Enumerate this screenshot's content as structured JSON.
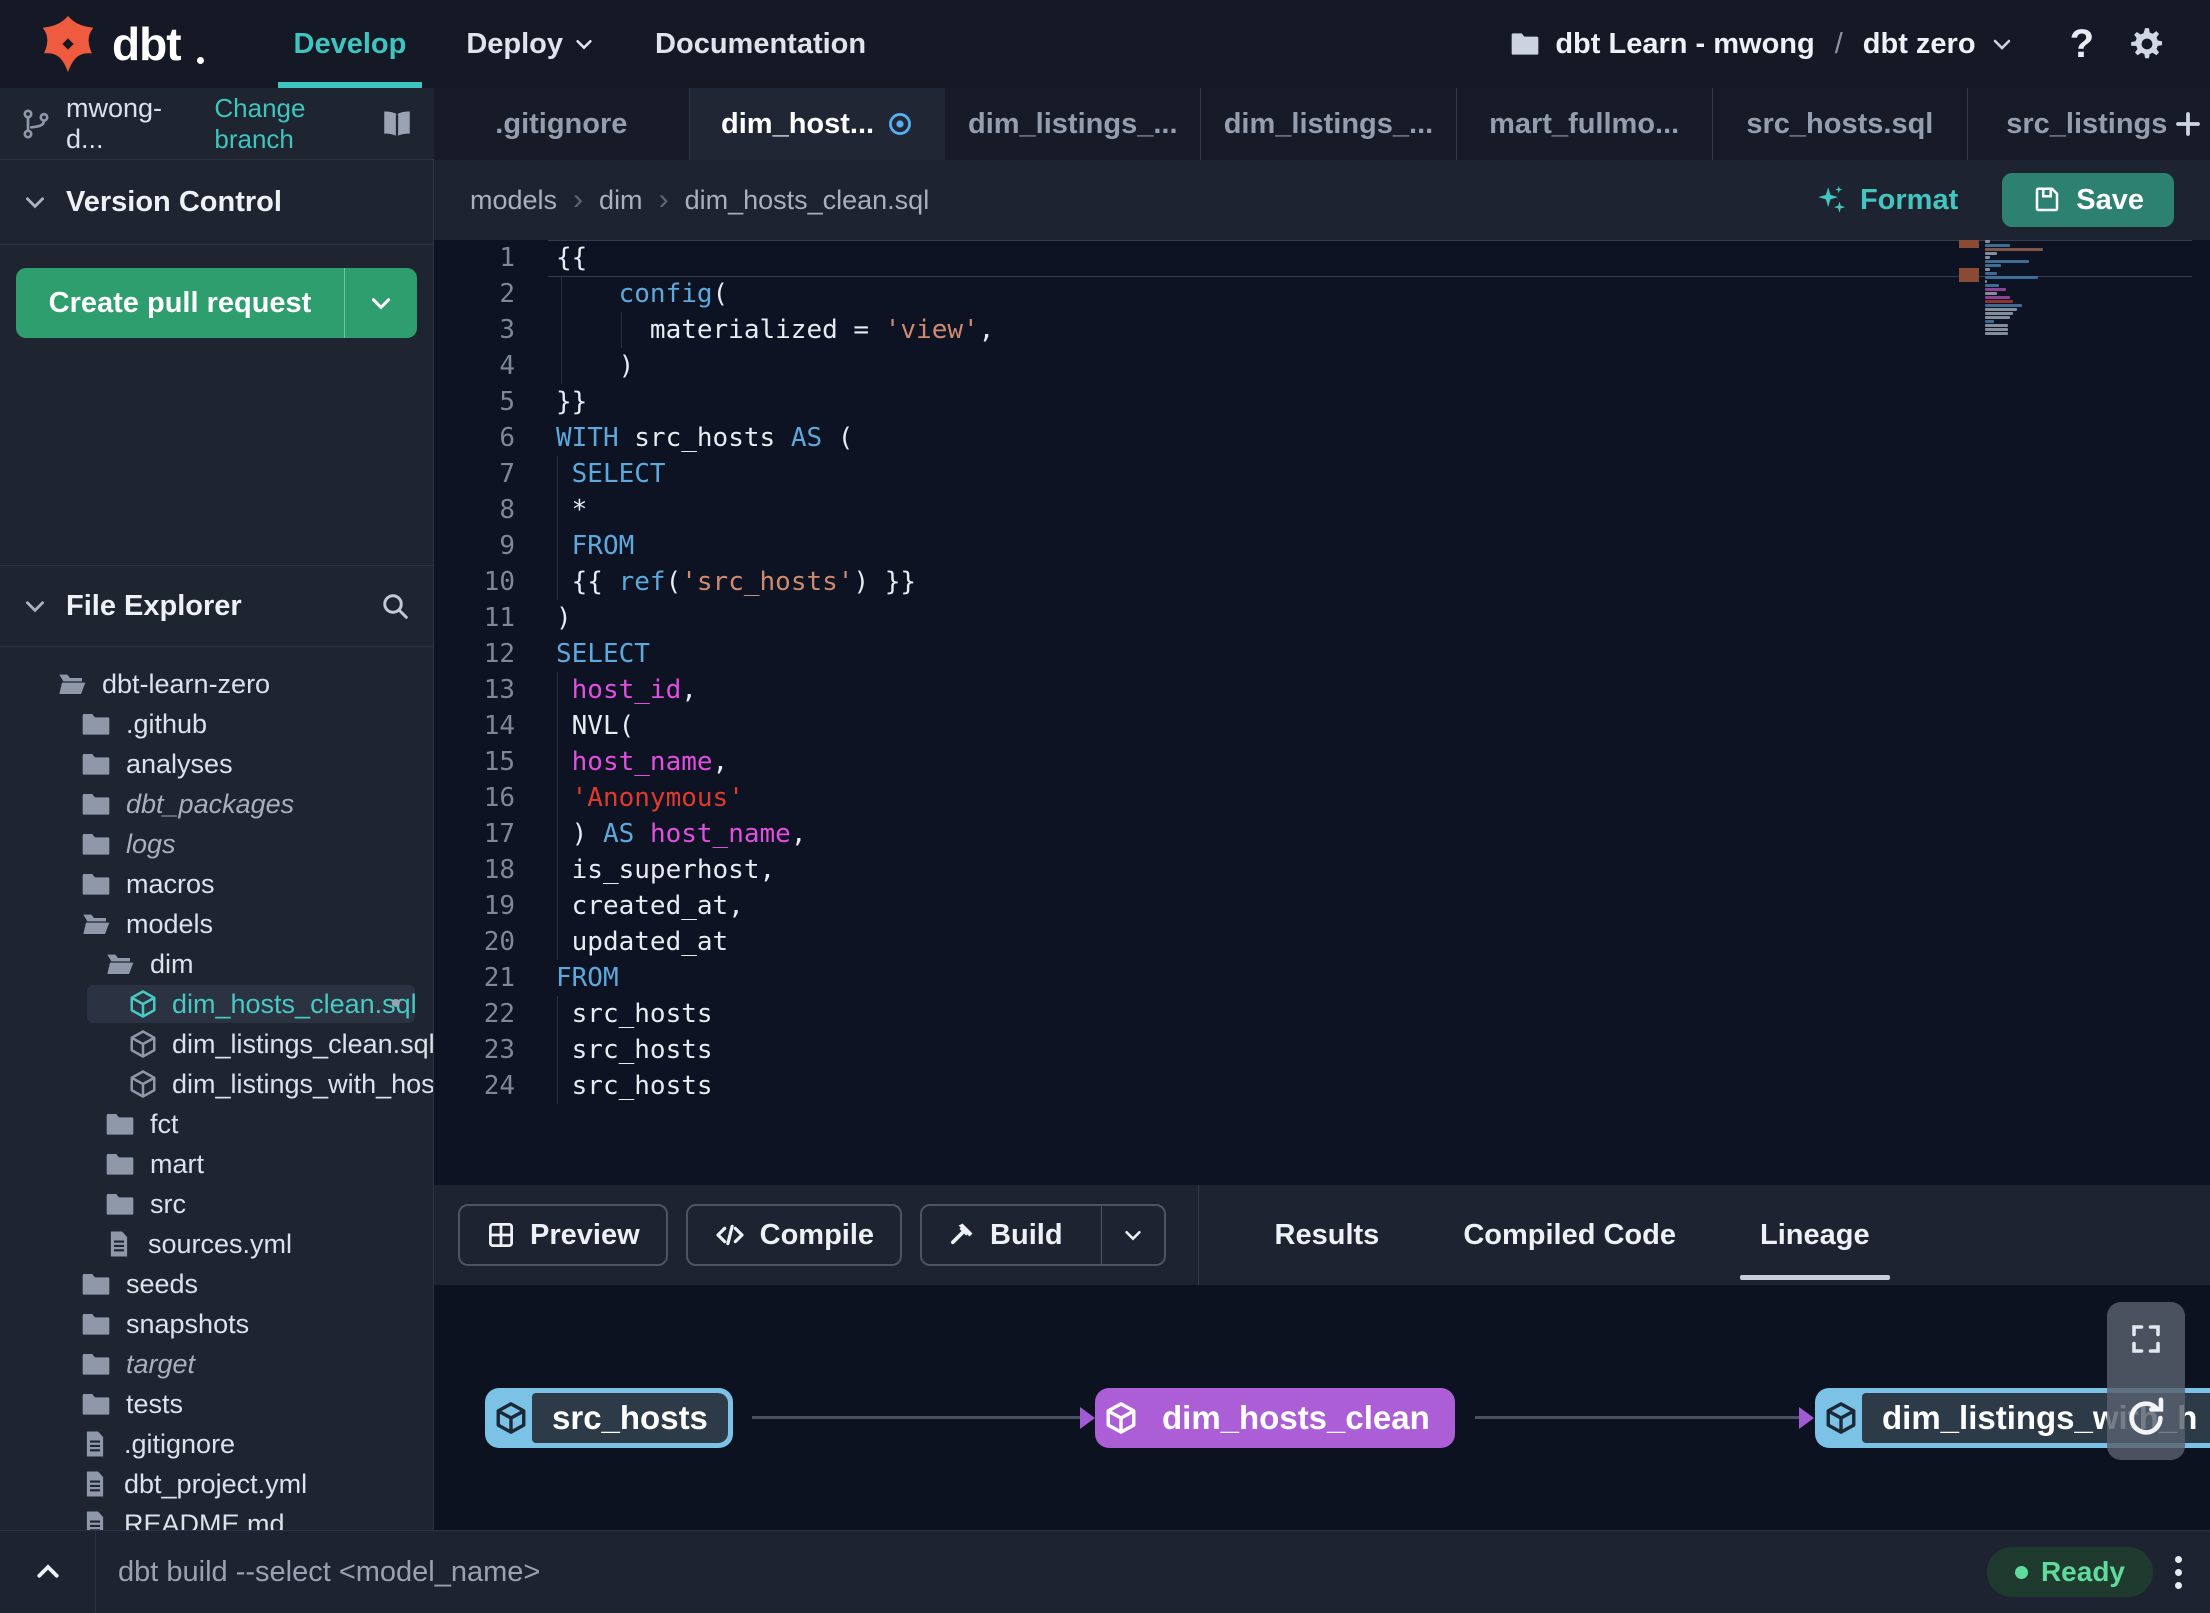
{
  "colors": {
    "brand_orange": "#ef5b3f",
    "accent_teal": "#3fc5bf",
    "button_green": "#2f9e6f",
    "save_teal": "#2c8170",
    "status_green": "#5fdc9c",
    "node_blue": "#7cc2e6",
    "node_purple": "#ac5ed7",
    "keyword_blue": "#5fa8dc",
    "ident_magenta": "#e04fdf",
    "string_coral": "#cd8a6f",
    "string_red": "#e0392d"
  },
  "navbar": {
    "brand": "dbt",
    "menu": [
      {
        "label": "Develop",
        "active": true,
        "caret": false
      },
      {
        "label": "Deploy",
        "active": false,
        "caret": true
      },
      {
        "label": "Documentation",
        "active": false,
        "caret": false
      }
    ],
    "project": {
      "name": "dbt Learn - mwong",
      "separator": "/",
      "env": "dbt zero"
    },
    "help_label": "?"
  },
  "sidebar": {
    "branch": {
      "name": "mwong-d...",
      "change_link": "Change branch"
    },
    "version_control": {
      "title": "Version Control",
      "button_label": "Create pull request"
    },
    "file_explorer": {
      "title": "File Explorer",
      "tree": [
        {
          "label": "dbt-learn-zero",
          "icon": "folder-open",
          "level": 0
        },
        {
          "label": ".github",
          "icon": "folder",
          "level": 1
        },
        {
          "label": "analyses",
          "icon": "folder",
          "level": 1
        },
        {
          "label": "dbt_packages",
          "icon": "folder",
          "level": 1,
          "italic": true
        },
        {
          "label": "logs",
          "icon": "folder",
          "level": 1,
          "italic": true
        },
        {
          "label": "macros",
          "icon": "folder",
          "level": 1
        },
        {
          "label": "models",
          "icon": "folder-open",
          "level": 1
        },
        {
          "label": "dim",
          "icon": "folder-open",
          "level": 2
        },
        {
          "label": "dim_hosts_clean.sql",
          "icon": "model",
          "level": 3,
          "selected": true,
          "modified": true
        },
        {
          "label": "dim_listings_clean.sql",
          "icon": "model",
          "level": 3
        },
        {
          "label": "dim_listings_with_hosts...",
          "icon": "model",
          "level": 3
        },
        {
          "label": "fct",
          "icon": "folder",
          "level": 2
        },
        {
          "label": "mart",
          "icon": "folder",
          "level": 2
        },
        {
          "label": "src",
          "icon": "folder",
          "level": 2
        },
        {
          "label": "sources.yml",
          "icon": "file",
          "level": 2
        },
        {
          "label": "seeds",
          "icon": "folder",
          "level": 1
        },
        {
          "label": "snapshots",
          "icon": "folder",
          "level": 1
        },
        {
          "label": "target",
          "icon": "folder",
          "level": 1,
          "italic": true
        },
        {
          "label": "tests",
          "icon": "folder",
          "level": 1
        },
        {
          "label": ".gitignore",
          "icon": "file",
          "level": 1
        },
        {
          "label": "dbt_project.yml",
          "icon": "file",
          "level": 1
        },
        {
          "label": "README.md",
          "icon": "file",
          "level": 1
        }
      ]
    }
  },
  "tabs": {
    "items": [
      {
        "label": ".gitignore"
      },
      {
        "label": "dim_host...",
        "active": true,
        "modified": true
      },
      {
        "label": "dim_listings_..."
      },
      {
        "label": "dim_listings_..."
      },
      {
        "label": "mart_fullmo..."
      },
      {
        "label": "src_hosts.sql"
      },
      {
        "label": "src_listings.",
        "clipped": true
      }
    ],
    "add_label": "+"
  },
  "editor": {
    "breadcrumb": [
      "models",
      "dim",
      "dim_hosts_clean.sql"
    ],
    "format_label": "Format",
    "save_label": "Save",
    "lines": [
      [
        {
          "t": "{{",
          "c": "d"
        }
      ],
      [
        {
          "t": "    ",
          "c": "d"
        },
        {
          "t": "config",
          "c": "k"
        },
        {
          "t": "(",
          "c": "d"
        }
      ],
      [
        {
          "t": "      materialized = ",
          "c": "d"
        },
        {
          "t": "'view'",
          "c": "s"
        },
        {
          "t": ",",
          "c": "d"
        }
      ],
      [
        {
          "t": "    )",
          "c": "d"
        }
      ],
      [
        {
          "t": "}}",
          "c": "d"
        }
      ],
      [
        {
          "t": "WITH",
          "c": "k"
        },
        {
          "t": " src_hosts ",
          "c": "d"
        },
        {
          "t": "AS",
          "c": "k"
        },
        {
          "t": " (",
          "c": "d"
        }
      ],
      [
        {
          "t": " ",
          "c": "d"
        },
        {
          "t": "SELECT",
          "c": "k"
        }
      ],
      [
        {
          "t": " *",
          "c": "d"
        }
      ],
      [
        {
          "t": " ",
          "c": "d"
        },
        {
          "t": "FROM",
          "c": "k"
        }
      ],
      [
        {
          "t": " {{ ",
          "c": "d"
        },
        {
          "t": "ref",
          "c": "k"
        },
        {
          "t": "(",
          "c": "d"
        },
        {
          "t": "'src_hosts'",
          "c": "s"
        },
        {
          "t": ") }}",
          "c": "d"
        }
      ],
      [
        {
          "t": ")",
          "c": "d"
        }
      ],
      [
        {
          "t": "SELECT",
          "c": "k"
        }
      ],
      [
        {
          "t": " ",
          "c": "d"
        },
        {
          "t": "host_id",
          "c": "m"
        },
        {
          "t": ",",
          "c": "d"
        }
      ],
      [
        {
          "t": " NVL(",
          "c": "d"
        }
      ],
      [
        {
          "t": " ",
          "c": "d"
        },
        {
          "t": "host_name",
          "c": "m"
        },
        {
          "t": ",",
          "c": "d"
        }
      ],
      [
        {
          "t": " ",
          "c": "d"
        },
        {
          "t": "'Anonymous'",
          "c": "r"
        }
      ],
      [
        {
          "t": " ) ",
          "c": "d"
        },
        {
          "t": "AS",
          "c": "k"
        },
        {
          "t": " ",
          "c": "d"
        },
        {
          "t": "host_name",
          "c": "m"
        },
        {
          "t": ",",
          "c": "d"
        }
      ],
      [
        {
          "t": " is_superhost,",
          "c": "d"
        }
      ],
      [
        {
          "t": " created_at,",
          "c": "d"
        }
      ],
      [
        {
          "t": " updated_at",
          "c": "d"
        }
      ],
      [
        {
          "t": "FROM",
          "c": "k"
        }
      ],
      [
        {
          "t": " src_hosts",
          "c": "d"
        }
      ],
      [
        {
          "t": " src_hosts",
          "c": "d"
        }
      ],
      [
        {
          "t": " src_hosts",
          "c": "d"
        }
      ]
    ]
  },
  "bottom_panel": {
    "buttons": [
      {
        "label": "Preview",
        "icon": "grid"
      },
      {
        "label": "Compile",
        "icon": "code"
      },
      {
        "label": "Build",
        "icon": "hammer",
        "split": true
      }
    ],
    "tabs": [
      {
        "label": "Results"
      },
      {
        "label": "Compiled Code"
      },
      {
        "label": "Lineage",
        "active": true
      }
    ]
  },
  "lineage": {
    "nodes": [
      {
        "label": "src_hosts",
        "color": "blue"
      },
      {
        "label": "dim_hosts_clean",
        "color": "purple"
      },
      {
        "label": "dim_listings_with_h",
        "color": "blue"
      }
    ]
  },
  "command_bar": {
    "placeholder": "dbt build --select <model_name>",
    "status": "Ready"
  }
}
